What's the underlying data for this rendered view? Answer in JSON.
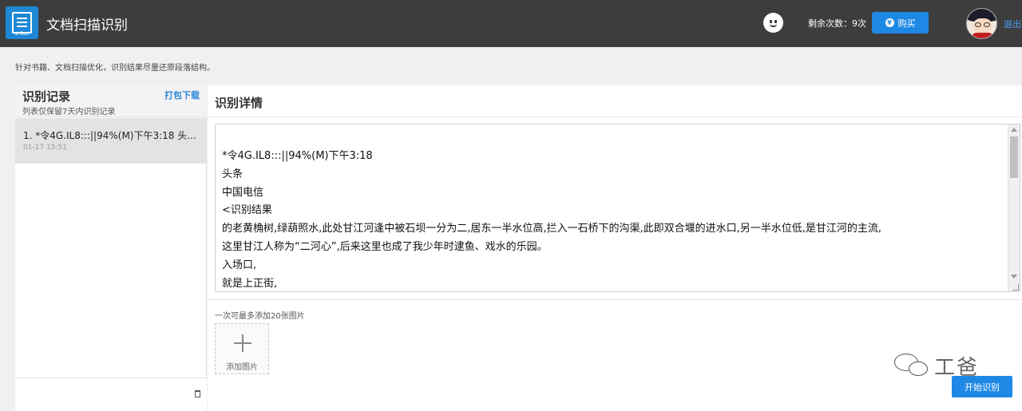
{
  "header": {
    "app_title": "文档扫描识别",
    "logo_tag": "≡ Doc",
    "remaining_label": "剩余次数：9次",
    "buy_label": "购买",
    "logout_label": "退出"
  },
  "subtitle": "针对书籍、文档扫描优化，识别结果尽量还原段落结构。",
  "records": {
    "title": "识别记录",
    "note": "列表仅保留7天内识别记录",
    "download_label": "打包下载",
    "items": [
      {
        "title": "1. *令4G.IL8:::||94%(M)下午3:18 头...",
        "time": "01-17 15:51"
      }
    ]
  },
  "detail": {
    "title": "识别详情",
    "result_lines": [
      "*令4G.IL8:::||94%(M)下午3:18",
      "头条",
      "中国电信",
      "<识别结果",
      "的老黄桷树,绿葫照水,此处甘江河逢中被石坝一分为二,居东一半水位高,拦入一石桥下的沟渠,此即双合堰的进水口,另一半水位低,是甘江河的主流,",
      "这里甘江人称为“二河心”,后来这里也成了我少年时逮鱼、戏水的乐园。",
      "入场口,",
      "就是上正街,"
    ],
    "limit_note": "一次可最多添加20张图片",
    "add_image_label": "添加图片",
    "start_label": "开始识别"
  },
  "watermark": "工爸",
  "colors": {
    "header_bg": "#3d3d3d",
    "accent": "#1e88e5",
    "link": "#2b86d8"
  }
}
